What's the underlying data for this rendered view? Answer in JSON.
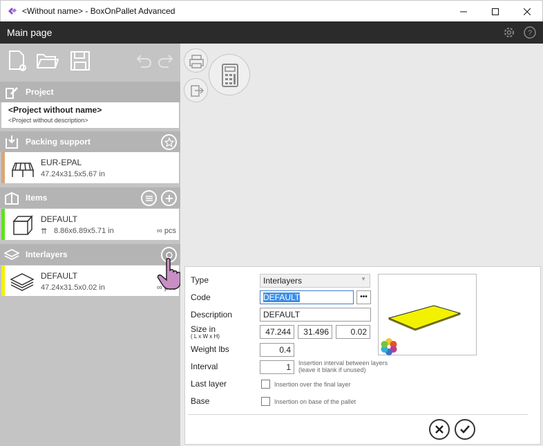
{
  "window": {
    "title": "<Without name> - BoxOnPallet Advanced",
    "minimize_icon": "minimize-icon",
    "maximize_icon": "maximize-icon",
    "close_icon": "close-icon"
  },
  "header": {
    "title": "Main page",
    "settings_icon": "gear-icon",
    "help_icon": "help-icon"
  },
  "toolbar": {
    "icons": [
      "new-file-icon",
      "open-folder-icon",
      "save-icon",
      "undo-icon",
      "redo-icon"
    ]
  },
  "project": {
    "header": "Project",
    "name": "<Project without name>",
    "description": "<Project without description>"
  },
  "packing_support": {
    "header": "Packing support",
    "name": "EUR-EPAL",
    "dimensions": "47.24x31.5x5.67 in",
    "color": "#d9a57a"
  },
  "items": {
    "header": "Items",
    "name": "DEFAULT",
    "dimensions": "8.86x6.89x5.71 in",
    "pcs": "∞ pcs",
    "color": "#5ce41a"
  },
  "interlayers": {
    "header": "Interlayers",
    "name": "DEFAULT",
    "dimensions": "47.24x31.5x0.02 in",
    "pcs": "∞ pcs",
    "color": "#f2f200"
  },
  "dialog": {
    "type_label": "Type",
    "type_value": "Interlayers",
    "code_label": "Code",
    "code_value": "DEFAULT",
    "more_label": "•••",
    "description_label": "Description",
    "description_value": "DEFAULT",
    "size_label": "Size in",
    "size_sub": "( L x W x H)",
    "size_l": "47.244",
    "size_w": "31.496",
    "size_h": "0.02",
    "weight_label": "Weight lbs",
    "weight_value": "0.4",
    "interval_label": "Interval",
    "interval_value": "1",
    "interval_hint1": "Insertion interval between layers",
    "interval_hint2": "(leave it blank if unused)",
    "last_layer_label": "Last layer",
    "last_layer_hint": "Insertion over the final layer",
    "base_label": "Base",
    "base_hint": "Insertion on base of the pallet",
    "cancel_icon": "close-circle-icon",
    "confirm_icon": "check-circle-icon",
    "preview_color": "#f2f200"
  }
}
